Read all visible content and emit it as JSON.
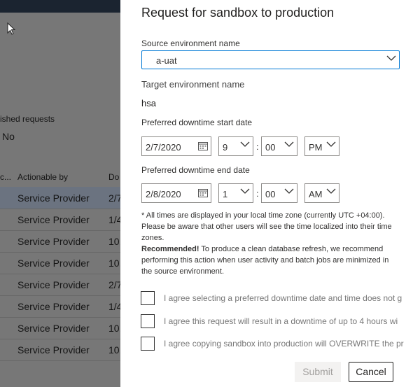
{
  "background": {
    "filter_label": "ished requests",
    "filter_value": "No",
    "col_trunc": "c...",
    "col_actionable": "Actionable by",
    "col_downtime": "Do",
    "rows": [
      {
        "actionable": "Service Provider",
        "date": "2/7"
      },
      {
        "actionable": "Service Provider",
        "date": "1/4"
      },
      {
        "actionable": "Service Provider",
        "date": "10,"
      },
      {
        "actionable": "Service Provider",
        "date": "10,"
      },
      {
        "actionable": "Service Provider",
        "date": "2/7"
      },
      {
        "actionable": "Service Provider",
        "date": "1/4"
      },
      {
        "actionable": "Service Provider",
        "date": "10,"
      },
      {
        "actionable": "Service Provider",
        "date": "10,"
      }
    ]
  },
  "panel": {
    "title": "Request for sandbox to production",
    "source_label": "Source environment name",
    "source_value": "a-uat",
    "target_label": "Target environment name",
    "target_value": "hsa",
    "start_label": "Preferred downtime start date",
    "start_date": "2/7/2020",
    "start_hour": "9",
    "start_minute": "00",
    "start_ampm": "PM",
    "end_label": "Preferred downtime end date",
    "end_date": "2/8/2020",
    "end_hour": "1",
    "end_minute": "00",
    "end_ampm": "AM",
    "time_sep": ":",
    "note_text": "* All times are displayed in your local time zone (currently UTC +04:00). Please be aware that other users will see the time localized into their time zones.",
    "recommended_label": "Recommended!",
    "recommended_text": " To produce a clean database refresh, we recommend performing this action when user activity and batch jobs are minimized in the source environment.",
    "agree1": "I agree selecting a preferred downtime date and time does not g",
    "agree2": "I agree this request will result in a downtime of up to 4 hours wi",
    "agree3": "I agree copying sandbox into production will OVERWRITE the pr",
    "submit_label": "Submit",
    "cancel_label": "Cancel"
  },
  "icons": {
    "cursor": "mouse-pointer-icon",
    "dropdown": "chevron-down-icon",
    "calendar": "calendar-icon"
  },
  "colors": {
    "accent": "#0078d4",
    "overlay": "#777777"
  }
}
